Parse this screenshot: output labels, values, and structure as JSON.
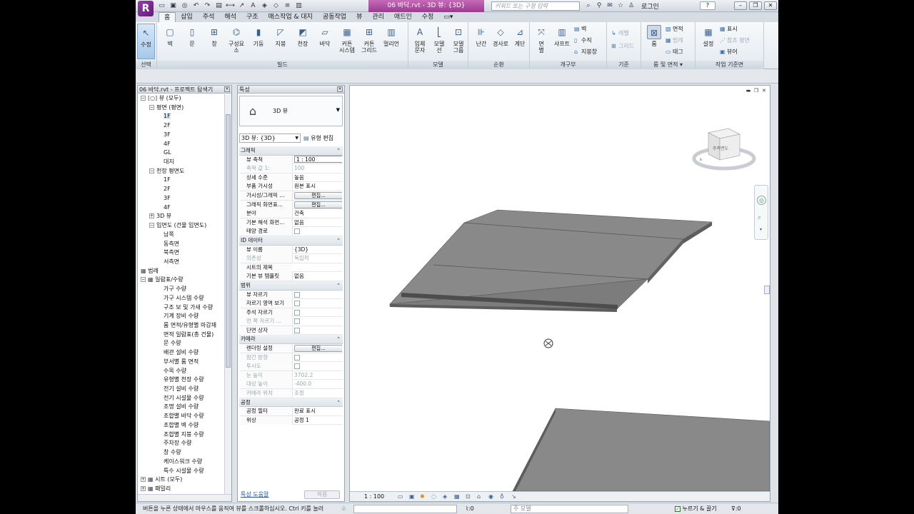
{
  "title_bar": {
    "logo_letter": "R",
    "document_title": "06 바닥.rvt - 3D 뷰: {3D}",
    "search_placeholder": "키워드 또는 구절 입력",
    "login_label": "로그인",
    "help_label": "?"
  },
  "ribbon": {
    "tabs": [
      "홈",
      "삽입",
      "주석",
      "해석",
      "구조",
      "매스작업 & 대지",
      "공동작업",
      "뷰",
      "관리",
      "애드인",
      "수정"
    ],
    "active_tab": "홈",
    "select_panel": {
      "modify_label": "수정",
      "panel_label": "선택"
    },
    "build_panel": {
      "panel_label": "빌드",
      "buttons": [
        "벽",
        "문",
        "창",
        "구성요소",
        "기둥",
        "지붕",
        "천장",
        "바닥",
        "커튼\n시스템",
        "커튼\n그리드",
        "멀리언"
      ]
    },
    "model_panel": {
      "panel_label": "모델",
      "buttons": [
        "입체\n문자",
        "모델\n선",
        "모델\n그룹"
      ]
    },
    "circulation_panel": {
      "panel_label": "순환",
      "buttons": [
        "난간",
        "경사로",
        "계단"
      ]
    },
    "opening_panel": {
      "panel_label": "개구부",
      "buttons": [
        "면\n별",
        "샤프트"
      ],
      "small": [
        "벽",
        "수직",
        "지붕창"
      ]
    },
    "datum_panel": {
      "panel_label": "기준",
      "small": [
        "레벨",
        "그리드"
      ]
    },
    "room_panel": {
      "panel_label": "룸 및 면적 ▾",
      "room_label": "룸",
      "small": [
        "면적",
        "범례",
        "태그"
      ]
    },
    "workplane_panel": {
      "panel_label": "작업 기준면",
      "set_label": "설정",
      "small": [
        "표시",
        "참조 평면",
        "뷰어"
      ]
    }
  },
  "project_browser": {
    "title": "06 바닥.rvt - 프로젝트 탐색기",
    "items": [
      {
        "label": "뷰 (모두)",
        "level": 0,
        "expander": "−",
        "icon": "[○]"
      },
      {
        "label": "평면 (평면)",
        "level": 1,
        "expander": "−"
      },
      {
        "label": "1F",
        "level": 2,
        "selected": true
      },
      {
        "label": "2F",
        "level": 2
      },
      {
        "label": "3F",
        "level": 2
      },
      {
        "label": "4F",
        "level": 2
      },
      {
        "label": "GL",
        "level": 2
      },
      {
        "label": "대지",
        "level": 2
      },
      {
        "label": "천장 평면도",
        "level": 1,
        "expander": "−"
      },
      {
        "label": "1F",
        "level": 2
      },
      {
        "label": "2F",
        "level": 2
      },
      {
        "label": "3F",
        "level": 2
      },
      {
        "label": "4F",
        "level": 2
      },
      {
        "label": "3D 뷰",
        "level": 1,
        "expander": "+"
      },
      {
        "label": "입면도 (건물 입면도)",
        "level": 1,
        "expander": "−"
      },
      {
        "label": "남쪽",
        "level": 2
      },
      {
        "label": "동측면",
        "level": 2
      },
      {
        "label": "북측면",
        "level": 2
      },
      {
        "label": "서측면",
        "level": 2
      },
      {
        "label": "범례",
        "level": 0,
        "icon": "▦"
      },
      {
        "label": "일람표/수량",
        "level": 0,
        "expander": "−",
        "icon": "▦"
      },
      {
        "label": "가구 수량",
        "level": 2
      },
      {
        "label": "가구 시스템 수량",
        "level": 2
      },
      {
        "label": "구조 보 및 가새 수량",
        "level": 2
      },
      {
        "label": "기계 장비 수량",
        "level": 2
      },
      {
        "label": "룸 면적/유형별 마감재",
        "level": 2
      },
      {
        "label": "면적 일람표(총 건물)",
        "level": 2
      },
      {
        "label": "문 수량",
        "level": 2
      },
      {
        "label": "배관 설비 수량",
        "level": 2
      },
      {
        "label": "부서별 룸 면적",
        "level": 2
      },
      {
        "label": "수목 수량",
        "level": 2
      },
      {
        "label": "유형별 천장 수량",
        "level": 2
      },
      {
        "label": "전기 설비 수량",
        "level": 2
      },
      {
        "label": "전기 시설물 수량",
        "level": 2
      },
      {
        "label": "조명 설비 수량",
        "level": 2
      },
      {
        "label": "조합별 바닥 수량",
        "level": 2
      },
      {
        "label": "조합별 벽 수량",
        "level": 2
      },
      {
        "label": "조합별 지붕 수량",
        "level": 2
      },
      {
        "label": "주차장 수량",
        "level": 2
      },
      {
        "label": "창 수량",
        "level": 2
      },
      {
        "label": "케이스워크 수량",
        "level": 2
      },
      {
        "label": "특수 시설물 수량",
        "level": 2
      },
      {
        "label": "시트 (모두)",
        "level": 0,
        "expander": "+",
        "icon": "▦"
      },
      {
        "label": "패밀리",
        "level": 0,
        "expander": "+",
        "icon": "▦"
      }
    ]
  },
  "properties": {
    "title": "특성",
    "type_name": "3D 뷰",
    "view_filter": "3D 뷰: {3D}",
    "edit_type_label": "유형 편집",
    "help_link": "특성 도움말",
    "apply_label": "적용",
    "rows": [
      {
        "group": "그래픽"
      },
      {
        "key": "뷰 축척",
        "value": "1 : 100",
        "input": true
      },
      {
        "key": "축척 값    1:",
        "value": "100",
        "disabled": true
      },
      {
        "key": "상세 수준",
        "value": "높음"
      },
      {
        "key": "부품 가시성",
        "value": "원본 표시"
      },
      {
        "key": "가시성/그래픽 ...",
        "button": "편집..."
      },
      {
        "key": "그래픽 화면표...",
        "button": "편집..."
      },
      {
        "key": "분야",
        "value": "건축"
      },
      {
        "key": "기본 해석 화면...",
        "value": "없음"
      },
      {
        "key": "태양 경로",
        "checkbox": true
      },
      {
        "group": "ID 데이터"
      },
      {
        "key": "뷰 이름",
        "value": "{3D}"
      },
      {
        "key": "의존성",
        "value": "독립적",
        "disabled": true
      },
      {
        "key": "시트의 제목",
        "value": ""
      },
      {
        "key": "기본 뷰 템플릿",
        "value": "없음"
      },
      {
        "group": "범위"
      },
      {
        "key": "뷰 자르기",
        "checkbox": true
      },
      {
        "key": "자르기 영역 보기",
        "checkbox": true
      },
      {
        "key": "주석 자르기",
        "checkbox": true
      },
      {
        "key": "먼 쪽 자르기 ...",
        "checkbox": true,
        "disabled": true
      },
      {
        "key": "단면 상자",
        "checkbox": true
      },
      {
        "group": "카메라"
      },
      {
        "key": "렌더링 설정",
        "button": "편집..."
      },
      {
        "key": "잠긴 방향",
        "checkbox": true,
        "disabled": true
      },
      {
        "key": "투시도",
        "checkbox": true,
        "disabled": true
      },
      {
        "key": "눈 높이",
        "value": "3702.2",
        "disabled": true
      },
      {
        "key": "대상 높이",
        "value": "-400.0",
        "disabled": true
      },
      {
        "key": "카메라 위치",
        "value": "조정",
        "disabled": true
      },
      {
        "group": "공정"
      },
      {
        "key": "공정 필터",
        "value": "완료 표시"
      },
      {
        "key": "위상",
        "value": "공정 1"
      }
    ]
  },
  "viewport": {
    "viewcube_face": "주측면도",
    "scale_label": "1 : 100"
  },
  "status_bar": {
    "message": "버튼을 누른 상태에서 마우스를 움직여 뷰를 스크롤하십시오. Ctrl 키를 눌러",
    "count": ":0",
    "model_placeholder": "주 모델",
    "press_drag_label": "누르기 & 끌기",
    "filter_count": ":0"
  },
  "colors": {
    "slab_top": "#898989",
    "slab_side": "#5c5c5c",
    "accent": "#9b3b8f"
  }
}
